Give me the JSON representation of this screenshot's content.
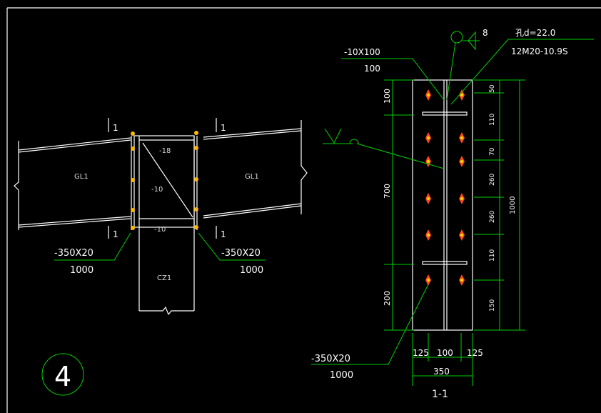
{
  "colors": {
    "background": "#000000",
    "line": "#ffffff",
    "leader": "#00d000",
    "bolt": "#ff4a1a",
    "bolt_left": "#ffb800"
  },
  "elevation": {
    "section_mark": "1",
    "beam_label": "GL1",
    "column_label": "CZ1",
    "stiffener_top": "-18",
    "stiffener_mid": "-10",
    "stiffener_bottom": "-10",
    "plate_spec": "-350X20",
    "plate_length": "1000"
  },
  "section": {
    "top_plate_spec": "-10X100",
    "top_plate_length": "100",
    "weld_size": "8",
    "hole_spec": "孔d=22.0",
    "bolt_spec": "12M20-10.9S",
    "left_dims": [
      "100",
      "700",
      "200"
    ],
    "right_dims": [
      "50",
      "110",
      "70",
      "260",
      "260",
      "110",
      "150"
    ],
    "overall_height": "1000",
    "bottom_dims": [
      "125",
      "100",
      "125"
    ],
    "overall_width": "350",
    "plate_spec": "-350X20",
    "plate_length": "1000",
    "title": "1-1"
  },
  "detail_number": "4"
}
